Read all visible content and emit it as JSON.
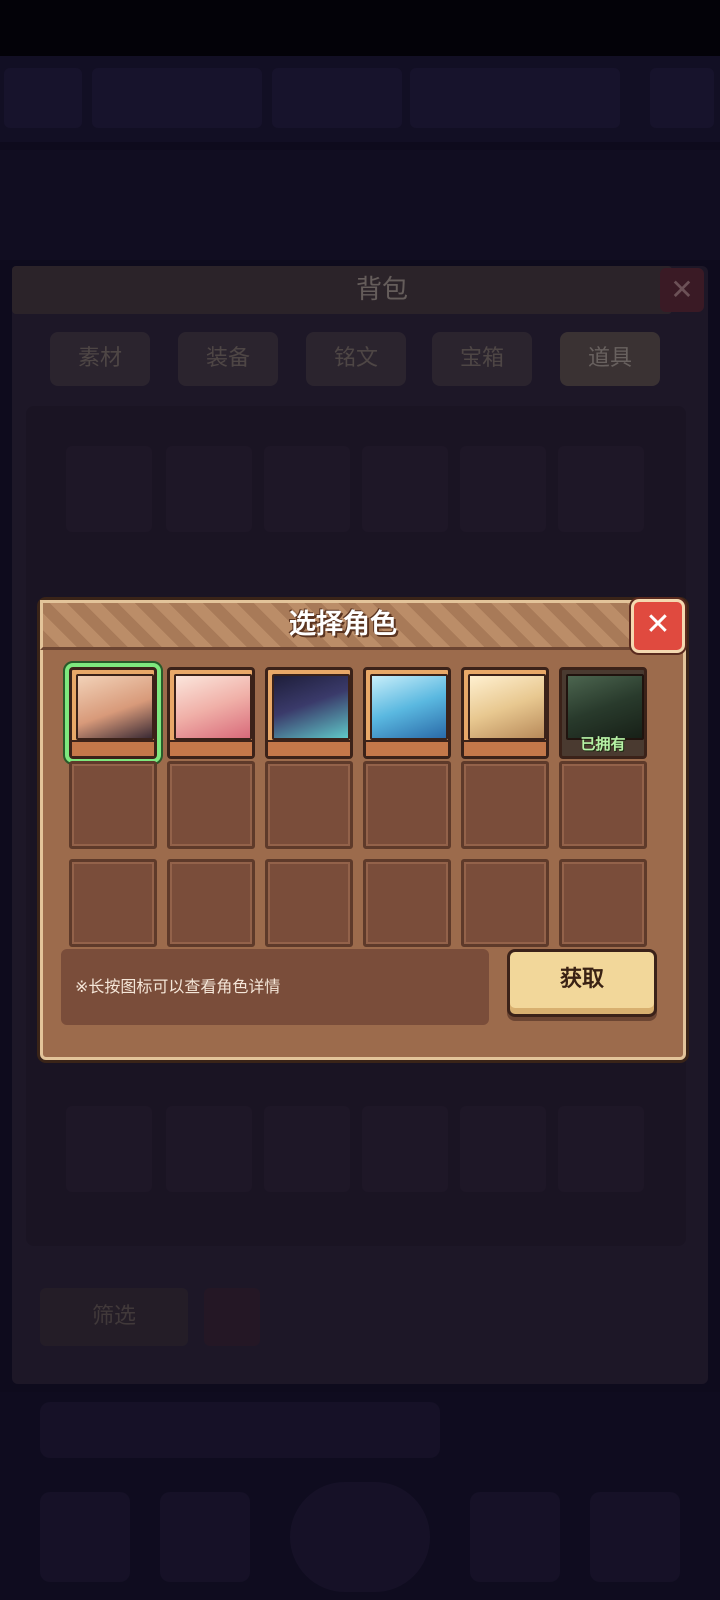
{
  "background": {
    "bag_title": "背包",
    "bag_tabs": [
      "素材",
      "装备",
      "铭文",
      "宝箱",
      "道具"
    ],
    "active_tab_index": 4,
    "filter_label": "筛选"
  },
  "dialog": {
    "title": "选择角色",
    "close_icon": "close-x-icon",
    "characters": [
      {
        "name": "character-1",
        "selected": true,
        "owned": false,
        "tint": "#d89a7a"
      },
      {
        "name": "character-2",
        "selected": false,
        "owned": false,
        "tint": "#f0b0a8"
      },
      {
        "name": "character-3",
        "selected": false,
        "owned": false,
        "tint": "#3a3a6a"
      },
      {
        "name": "character-4",
        "selected": false,
        "owned": false,
        "tint": "#5ab8e0"
      },
      {
        "name": "character-5",
        "selected": false,
        "owned": false,
        "tint": "#e8c890"
      },
      {
        "name": "character-6",
        "selected": false,
        "owned": true,
        "tint": "#4a6a50",
        "owned_label": "已拥有"
      }
    ],
    "empty_slot_rows": 2,
    "hint": "※长按图标可以查看角色详情",
    "get_button_label": "获取"
  },
  "colors": {
    "dialog_bg": "#9c6b4c",
    "selected_outline": "#7ee87e",
    "close_button": "#e04a3f",
    "get_button": "#f2d79a"
  }
}
